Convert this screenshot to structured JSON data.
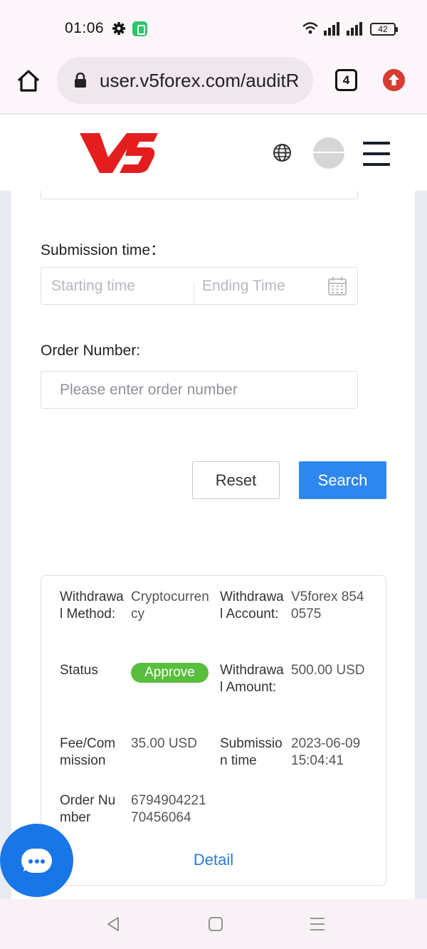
{
  "status_bar": {
    "time": "01:06",
    "battery": "42"
  },
  "browser": {
    "url": "user.v5forex.com/auditR",
    "tab_count": "4"
  },
  "site": {
    "logo_text": "V5"
  },
  "filters": {
    "submission_time_label": "Submission time：",
    "start_placeholder": "Starting time",
    "end_placeholder": "Ending Time",
    "order_number_label": "Order Number:",
    "order_number_placeholder": "Please enter order number"
  },
  "buttons": {
    "reset": "Reset",
    "search": "Search"
  },
  "record": {
    "method_label": "Withdrawal Method:",
    "method_value": "Cryptocurrency",
    "account_label": "Withdrawal Account:",
    "account_value": "V5forex 8540575",
    "status_label": "Status",
    "status_value": "Approve",
    "status_color": "#59bd3e",
    "amount_label": "Withdrawal Amount:",
    "amount_value": "500.00 USD",
    "fee_label": "Fee/Commission",
    "fee_value": "35.00 USD",
    "time_label": "Submission time",
    "time_value": "2023-06-09 15:04:41",
    "order_label": "Order Number",
    "order_value": "679490422170456064",
    "detail_link": "Detail"
  },
  "colors": {
    "primary": "#2e86ef",
    "brand_red": "#e41e1e",
    "success": "#59bd3e"
  }
}
